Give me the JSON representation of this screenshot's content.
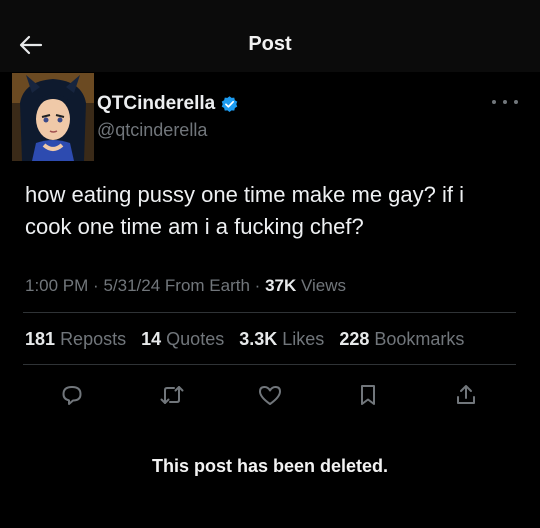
{
  "header": {
    "title": "Post"
  },
  "user": {
    "display_name": "QTCinderella",
    "handle": "@qtcinderella",
    "verified_color": "#1d9bf0"
  },
  "tweet": {
    "text": "how eating pussy one time make me gay? if i cook one time am i a fucking chef?",
    "time": "1:00 PM",
    "date": "5/31/24",
    "source": "From Earth",
    "views_count": "37K",
    "views_label": "Views"
  },
  "stats": {
    "reposts_count": "181",
    "reposts_label": "Reposts",
    "quotes_count": "14",
    "quotes_label": "Quotes",
    "likes_count": "3.3K",
    "likes_label": "Likes",
    "bookmarks_count": "228",
    "bookmarks_label": "Bookmarks"
  },
  "actions": [
    "reply-icon",
    "repost-icon",
    "like-icon",
    "bookmark-icon",
    "share-icon"
  ],
  "notice": "This post has been deleted."
}
